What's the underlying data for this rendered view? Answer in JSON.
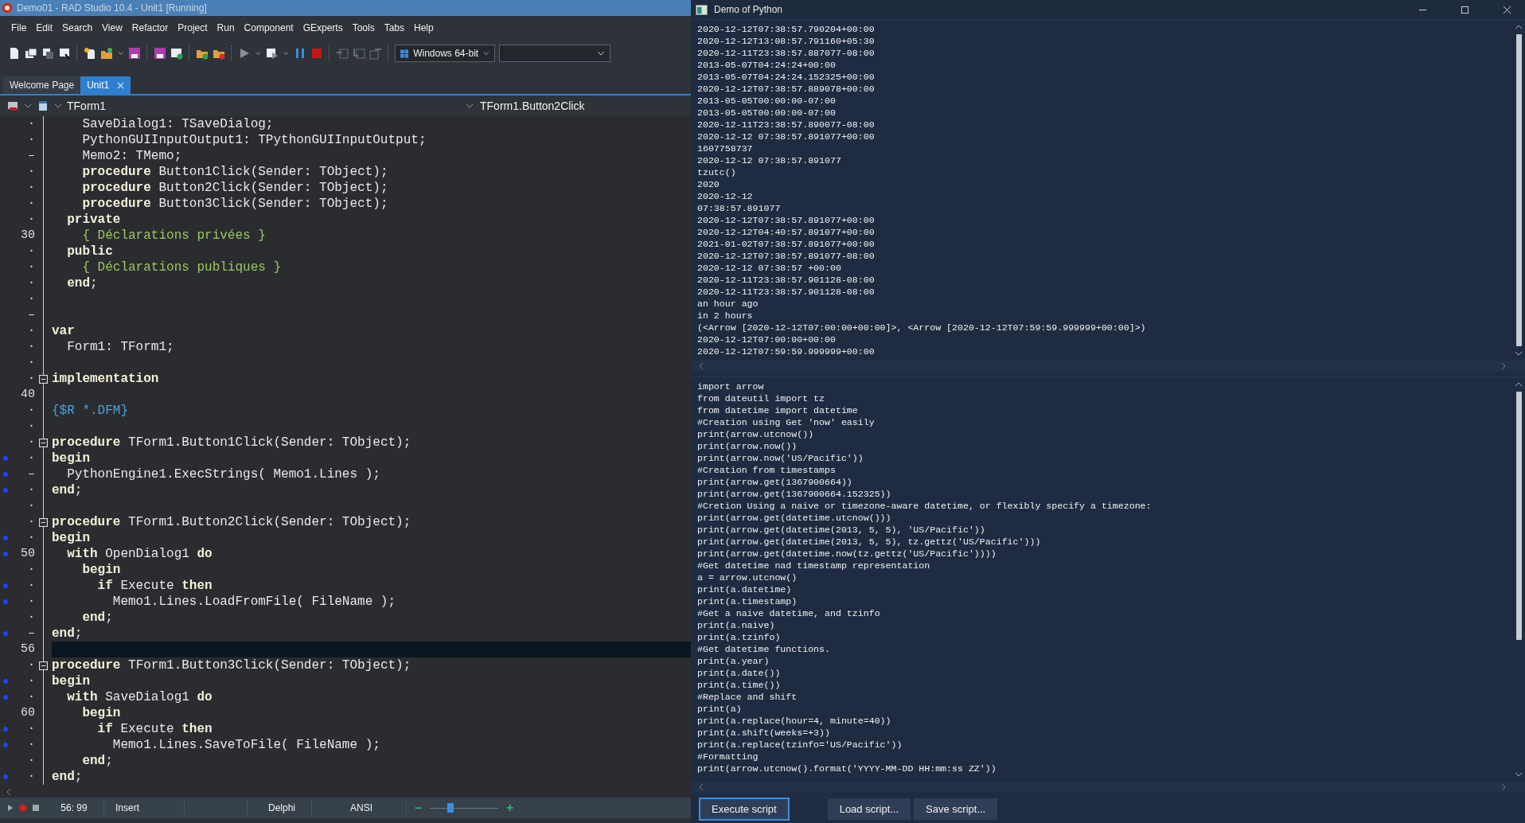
{
  "ide": {
    "window": {
      "title": "Demo01 - RAD Studio 10.4 - Unit1 [Running]"
    },
    "menu": [
      "File",
      "Edit",
      "Search",
      "View",
      "Refactor",
      "Project",
      "Run",
      "Component",
      "GExperts",
      "Tools",
      "Tabs",
      "Help"
    ],
    "platform": {
      "value": "Windows 64-bit"
    },
    "tabs": [
      {
        "label": "Welcome Page",
        "selected": false
      },
      {
        "label": "Unit1",
        "selected": true
      }
    ],
    "editor_header": {
      "unit": "TForm1",
      "method": "TForm1.Button2Click"
    },
    "code": [
      {
        "gutter": "·",
        "text": "    SaveDialog1: TSaveDialog;",
        "kind": "code",
        "breakpoint": false,
        "fold": false,
        "current": false
      },
      {
        "gutter": "·",
        "text": "    PythonGUIInputOutput1: TPythonGUIInputOutput;",
        "kind": "code",
        "breakpoint": false,
        "fold": false,
        "current": false
      },
      {
        "gutter": "–",
        "text": "    Memo2: TMemo;",
        "kind": "code",
        "breakpoint": false,
        "fold": false,
        "current": false
      },
      {
        "gutter": "·",
        "text": "    **procedure** Button1Click(Sender: TObject);",
        "kind": "code",
        "breakpoint": false,
        "fold": false,
        "current": false
      },
      {
        "gutter": "·",
        "text": "    **procedure** Button2Click(Sender: TObject);",
        "kind": "code",
        "breakpoint": false,
        "fold": false,
        "current": false
      },
      {
        "gutter": "·",
        "text": "    **procedure** Button3Click(Sender: TObject);",
        "kind": "code",
        "breakpoint": false,
        "fold": false,
        "current": false
      },
      {
        "gutter": "·",
        "text": "  **private**",
        "kind": "code",
        "breakpoint": false,
        "fold": false,
        "current": false
      },
      {
        "gutter": "30",
        "text": "    { Déclarations privées }",
        "kind": "comment",
        "breakpoint": false,
        "fold": false,
        "current": false
      },
      {
        "gutter": "·",
        "text": "  **public**",
        "kind": "code",
        "breakpoint": false,
        "fold": false,
        "current": false
      },
      {
        "gutter": "·",
        "text": "    { Déclarations publiques }",
        "kind": "comment",
        "breakpoint": false,
        "fold": false,
        "current": false
      },
      {
        "gutter": "·",
        "text": "  **end**;",
        "kind": "code",
        "breakpoint": false,
        "fold": false,
        "current": false
      },
      {
        "gutter": "·",
        "kind": "code",
        "breakpoint": false,
        "fold": false,
        "current": false
      },
      {
        "gutter": "–",
        "kind": "code",
        "breakpoint": false,
        "fold": false,
        "current": false
      },
      {
        "gutter": "·",
        "text": "**var**",
        "kind": "code",
        "breakpoint": false,
        "fold": false,
        "current": false
      },
      {
        "gutter": "·",
        "text": "  Form1: TForm1;",
        "kind": "code",
        "breakpoint": false,
        "fold": false,
        "current": false
      },
      {
        "gutter": "·",
        "kind": "code",
        "breakpoint": false,
        "fold": false,
        "current": false
      },
      {
        "gutter": "·",
        "text": "**implementation**",
        "kind": "code",
        "breakpoint": false,
        "fold": true,
        "current": false
      },
      {
        "gutter": "40",
        "kind": "code",
        "breakpoint": false,
        "fold": false,
        "current": false
      },
      {
        "gutter": "·",
        "text": "{$R *.DFM}",
        "kind": "directive",
        "breakpoint": false,
        "fold": false,
        "current": false
      },
      {
        "gutter": "·",
        "kind": "code",
        "breakpoint": false,
        "fold": false,
        "current": false
      },
      {
        "gutter": "·",
        "text": "**procedure** TForm1.Button1Click(Sender: TObject);",
        "kind": "code",
        "breakpoint": false,
        "fold": true,
        "current": false
      },
      {
        "gutter": "·",
        "text": "**begin**",
        "kind": "code",
        "breakpoint": true,
        "fold": false,
        "current": false
      },
      {
        "gutter": "–",
        "text": "  PythonEngine1.ExecStrings( Memo1.Lines );",
        "kind": "code",
        "breakpoint": true,
        "fold": false,
        "current": false
      },
      {
        "gutter": "·",
        "text": "**end**;",
        "kind": "code",
        "breakpoint": true,
        "fold": false,
        "current": false
      },
      {
        "gutter": "·",
        "kind": "code",
        "breakpoint": false,
        "fold": false,
        "current": false
      },
      {
        "gutter": "·",
        "text": "**procedure** TForm1.Button2Click(Sender: TObject);",
        "kind": "code",
        "breakpoint": false,
        "fold": true,
        "current": false
      },
      {
        "gutter": "·",
        "text": "**begin**",
        "kind": "code",
        "breakpoint": true,
        "fold": false,
        "current": false
      },
      {
        "gutter": "50",
        "text": "  **with** OpenDialog1 **do**",
        "kind": "code",
        "breakpoint": true,
        "fold": false,
        "current": false
      },
      {
        "gutter": "·",
        "text": "    **begin**",
        "kind": "code",
        "breakpoint": false,
        "fold": false,
        "current": false
      },
      {
        "gutter": "·",
        "text": "      **if** Execute **then**",
        "kind": "code",
        "breakpoint": true,
        "fold": false,
        "current": false
      },
      {
        "gutter": "·",
        "text": "        Memo1.Lines.LoadFromFile( FileName );",
        "kind": "code",
        "breakpoint": true,
        "fold": false,
        "current": false
      },
      {
        "gutter": "·",
        "text": "    **end**;",
        "kind": "code",
        "breakpoint": false,
        "fold": false,
        "current": false
      },
      {
        "gutter": "–",
        "text": "**end**;",
        "kind": "code",
        "breakpoint": true,
        "fold": false,
        "current": false
      },
      {
        "gutter": "56",
        "kind": "code",
        "breakpoint": false,
        "fold": false,
        "current": true
      },
      {
        "gutter": "·",
        "text": "**procedure** TForm1.Button3Click(Sender: TObject);",
        "kind": "code",
        "breakpoint": false,
        "fold": true,
        "current": false
      },
      {
        "gutter": "·",
        "text": "**begin**",
        "kind": "code",
        "breakpoint": true,
        "fold": false,
        "current": false
      },
      {
        "gutter": "·",
        "text": "  **with** SaveDialog1 **do**",
        "kind": "code",
        "breakpoint": true,
        "fold": false,
        "current": false
      },
      {
        "gutter": "60",
        "text": "    **begin**",
        "kind": "code",
        "breakpoint": false,
        "fold": false,
        "current": false
      },
      {
        "gutter": "·",
        "text": "      **if** Execute **then**",
        "kind": "code",
        "breakpoint": true,
        "fold": false,
        "current": false
      },
      {
        "gutter": "·",
        "text": "        Memo1.Lines.SaveToFile( FileName );",
        "kind": "code",
        "breakpoint": true,
        "fold": false,
        "current": false
      },
      {
        "gutter": "·",
        "text": "    **end**;",
        "kind": "code",
        "breakpoint": false,
        "fold": false,
        "current": false
      },
      {
        "gutter": "·",
        "text": "**end**;",
        "kind": "code",
        "breakpoint": true,
        "fold": false,
        "current": false
      }
    ],
    "status_bar": {
      "position": "56: 99",
      "mode": "Insert",
      "language": "Delphi",
      "encoding": "ANSI",
      "zoom_minus": "–",
      "zoom_plus": "+",
      "zoom": {
        "level": 0.3
      }
    }
  },
  "python_demo": {
    "window": {
      "title": "Demo of Python"
    },
    "output": [
      "2020-12-12T07:38:57.790204+00:00",
      "2020-12-12T13:08:57.791160+05:30",
      "2020-12-11T23:38:57.887077-08:00",
      "2013-05-07T04:24:24+00:00",
      "2013-05-07T04:24:24.152325+00:00",
      "2020-12-12T07:38:57.889078+00:00",
      "2013-05-05T00:00:00-07:00",
      "2013-05-05T00:00:00-07:00",
      "2020-12-11T23:38:57.890077-08:00",
      "2020-12-12 07:38:57.891077+00:00",
      "1607758737",
      "2020-12-12 07:38:57.891077",
      "tzutc()",
      "2020",
      "2020-12-12",
      "07:38:57.891077",
      "2020-12-12T07:38:57.891077+00:00",
      "2020-12-12T04:40:57.891077+00:00",
      "2021-01-02T07:38:57.891077+00:00",
      "2020-12-12T07:38:57.891077-08:00",
      "2020-12-12 07:38:57 +00:00",
      "2020-12-11T23:38:57.901128-08:00",
      "2020-12-11T23:38:57.901128-08:00",
      "an hour ago",
      "in 2 hours",
      "(<Arrow [2020-12-12T07:00:00+00:00]>, <Arrow [2020-12-12T07:59:59.999999+00:00]>)",
      "2020-12-12T07:00:00+00:00",
      "2020-12-12T07:59:59.999999+00:00"
    ],
    "script": [
      "import arrow",
      "from dateutil import tz",
      "from datetime import datetime",
      "#Creation using Get 'now' easily",
      "print(arrow.utcnow())",
      "print(arrow.now())",
      "print(arrow.now('US/Pacific'))",
      "#Creation from timestamps",
      "print(arrow.get(1367900664))",
      "print(arrow.get(1367900664.152325))",
      "#Cretion Using a naive or timezone-aware datetime, or flexibly specify a timezone:",
      "print(arrow.get(datetime.utcnow()))",
      "print(arrow.get(datetime(2013, 5, 5), 'US/Pacific'))",
      "print(arrow.get(datetime(2013, 5, 5), tz.gettz('US/Pacific')))",
      "print(arrow.get(datetime.now(tz.gettz('US/Pacific'))))",
      "#Get datetime nad timestamp representation",
      "a = arrow.utcnow()",
      "print(a.datetime)",
      "print(a.timestamp)",
      "#Get a naive datetime, and tzinfo",
      "print(a.naive)",
      "print(a.tzinfo)",
      "#Get datetime functions.",
      "print(a.year)",
      "print(a.date())",
      "print(a.time())",
      "#Replace and shift",
      "print(a)",
      "print(a.replace(hour=4, minute=40))",
      "print(a.shift(weeks=+3))",
      "print(a.replace(tzinfo='US/Pacific'))",
      "#Formatting",
      "print(arrow.utcnow().format('YYYY-MM-DD HH:mm:ss ZZ'))"
    ],
    "buttons": [
      {
        "label": "Execute script",
        "focused": true
      },
      {
        "label": "Load script...",
        "focused": false
      },
      {
        "label": "Save script...",
        "focused": false
      }
    ]
  }
}
